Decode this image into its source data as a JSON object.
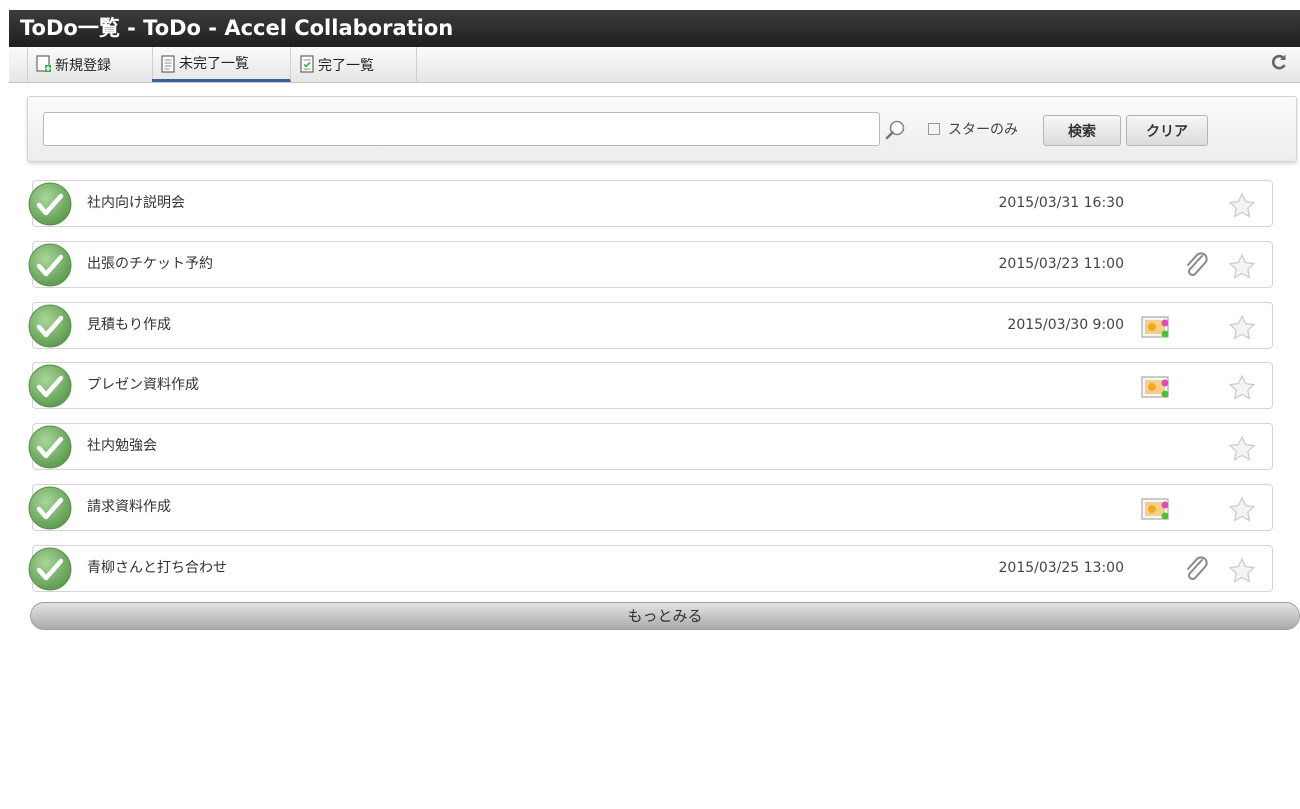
{
  "window": {
    "title": "ToDo一覧 - ToDo - Accel Collaboration"
  },
  "tabs": {
    "new": {
      "label": "新規登録",
      "icon": "new-document-icon"
    },
    "incomplete": {
      "label": "未完了一覧",
      "icon": "document-list-icon",
      "active": true
    },
    "complete": {
      "label": "完了一覧",
      "icon": "checked-document-icon"
    }
  },
  "toolbar": {
    "refresh_icon": "refresh-icon"
  },
  "search": {
    "value": "",
    "placeholder": "",
    "star_only_label": "スターのみ",
    "search_button": "検索",
    "clear_button": "クリア"
  },
  "todos": [
    {
      "title": "社内向け説明会",
      "date": "2015/03/31 16:30",
      "attachment": false,
      "image": false,
      "starred": false
    },
    {
      "title": "出張のチケット予約",
      "date": "2015/03/23 11:00",
      "attachment": true,
      "image": false,
      "starred": false
    },
    {
      "title": "見積もり作成",
      "date": "2015/03/30 9:00",
      "attachment": false,
      "image": true,
      "starred": false
    },
    {
      "title": "プレゼン資料作成",
      "date": "",
      "attachment": false,
      "image": true,
      "starred": false
    },
    {
      "title": "社内勉強会",
      "date": "",
      "attachment": false,
      "image": false,
      "starred": false
    },
    {
      "title": "請求資料作成",
      "date": "",
      "attachment": false,
      "image": true,
      "starred": false
    },
    {
      "title": "青柳さんと打ち合わせ",
      "date": "2015/03/25 13:00",
      "attachment": true,
      "image": false,
      "starred": false
    }
  ],
  "more_button": "もっとみる",
  "colors": {
    "titlebar": "#2a2a2a",
    "tab_active_underline": "#3e5f9e",
    "check_green": "#7fb86a"
  }
}
